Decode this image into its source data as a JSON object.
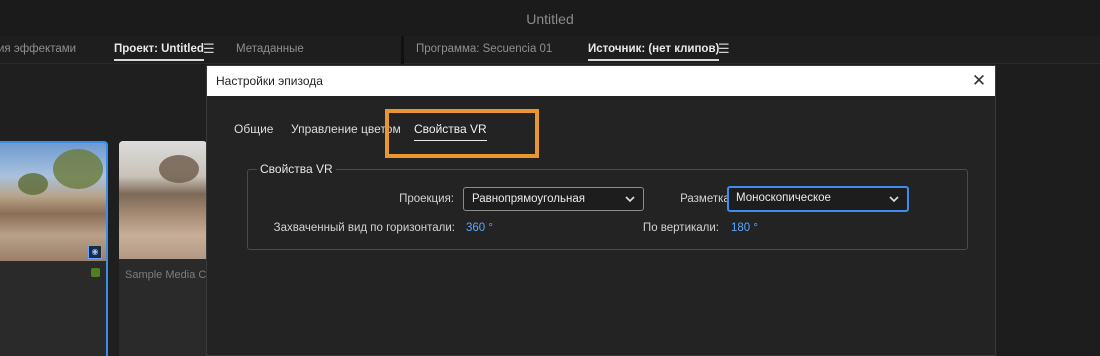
{
  "app": {
    "title": "Untitled"
  },
  "panel_tabs": {
    "effects_partial": "ия эффектами",
    "project": "Проект: Untitled",
    "metadata": "Метаданные",
    "program": "Программа: Secuencia 01",
    "source": "Источник: (нет клипов)"
  },
  "clips": [
    {
      "name": ""
    },
    {
      "name": "Sample Media Cl"
    }
  ],
  "dialog": {
    "title": "Настройки эпизода",
    "tabs": [
      "Общие",
      "Управление цветом",
      "Свойства VR"
    ],
    "active_tab": "Свойства VR",
    "group_title": "Свойства VR",
    "projection": {
      "label": "Проекция:",
      "value": "Равнопрямоугольная"
    },
    "layout": {
      "label": "Разметка:",
      "value": "Моноскопическое"
    },
    "horizontal": {
      "label": "Захваченный вид по горизонтали:",
      "value": "360 °"
    },
    "vertical": {
      "label": "По вертикали:",
      "value": "180 °"
    }
  },
  "colors": {
    "accent": "#3f8cf0",
    "highlight": "#e8962f",
    "value_text": "#5aa6ff"
  },
  "icons": [
    "hamburger-menu-icon",
    "close-icon",
    "chevron-down-icon",
    "vr-badge-icon"
  ]
}
